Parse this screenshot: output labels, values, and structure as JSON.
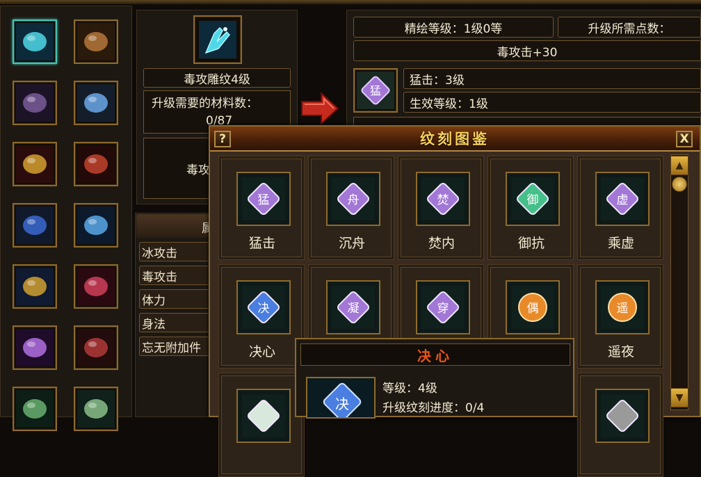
{
  "left_grid": {
    "slots": [
      {
        "icon": "cyan-claw-weapon-icon",
        "selected": true
      },
      {
        "icon": "bronze-ring-icon"
      },
      {
        "icon": "purple-armor-icon"
      },
      {
        "icon": "blue-gem-ring-icon"
      },
      {
        "icon": "red-gold-gauntlet-icon"
      },
      {
        "icon": "red-bracer-icon"
      },
      {
        "icon": "blue-red-shoulder-icon"
      },
      {
        "icon": "blue-needle-icon"
      },
      {
        "icon": "blue-gold-belt-icon"
      },
      {
        "icon": "red-glove-icon"
      },
      {
        "icon": "purple-blade-icon"
      },
      {
        "icon": "red-boots-icon"
      },
      {
        "icon": "jade-pendant-icon"
      },
      {
        "icon": "jade-amulet-icon"
      }
    ]
  },
  "center_panel": {
    "item_icon": "cyan-claw-weapon-icon",
    "item_name": "毒攻雕纹4级",
    "material_label": "升级需要的材料数：",
    "material_value": "0/87",
    "partial_text": "毒攻",
    "arrow_icon": "red-arrow-icon",
    "section_partial": "属"
  },
  "attributes": [
    "冰攻击",
    "毒攻击",
    "体力",
    "身法",
    "忘无附加件"
  ],
  "right_panel": {
    "refine_level": "精绘等级：1级0等",
    "upgrade_points": "升级所需点数：",
    "attack_bonus": "毒攻击+30",
    "skill_icon": "purple-rune-gem-icon",
    "skill_name": "猛击：3级",
    "effect_level": "生效等级：1级"
  },
  "dialog": {
    "title": "纹刻图鉴",
    "help_label": "?",
    "close_label": "X",
    "cards": [
      {
        "name": "猛击",
        "icon": "purple-rune-meng-icon",
        "glyph": "猛",
        "color": "#a277d6"
      },
      {
        "name": "沉舟",
        "icon": "purple-rune-zhou-icon",
        "glyph": "舟",
        "color": "#a277d6"
      },
      {
        "name": "焚内",
        "icon": "purple-rune-fen-icon",
        "glyph": "焚",
        "color": "#a277d6"
      },
      {
        "name": "御抗",
        "icon": "green-rune-yu-icon",
        "glyph": "御",
        "color": "#46c08a"
      },
      {
        "name": "乘虚",
        "icon": "purple-rune-xu-icon",
        "glyph": "虚",
        "color": "#a277d6"
      },
      {
        "name": "决心",
        "icon": "blue-rune-jue-icon",
        "glyph": "决",
        "color": "#4a7ee0"
      },
      {
        "name": "",
        "icon": "purple-rune-ning-icon",
        "glyph": "凝",
        "color": "#a277d6"
      },
      {
        "name": "",
        "icon": "purple-rune-chuan-icon",
        "glyph": "穿",
        "color": "#a277d6"
      },
      {
        "name": "",
        "icon": "orange-rune-coin-icon",
        "glyph": "偶",
        "color": "#e88a2a"
      },
      {
        "name": "遥夜",
        "icon": "orange-rune-yao-icon",
        "glyph": "遥",
        "color": "#e88a2a"
      }
    ],
    "third_row_icons": [
      "white-rune-icon",
      "grey-rune-icon"
    ]
  },
  "tooltip": {
    "title": "决心",
    "icon": "blue-rune-jue-icon",
    "level": "等级：4级",
    "progress": "升级纹刻进度：0/4"
  },
  "scrollbar": {
    "up": "▲",
    "down": "▼"
  }
}
